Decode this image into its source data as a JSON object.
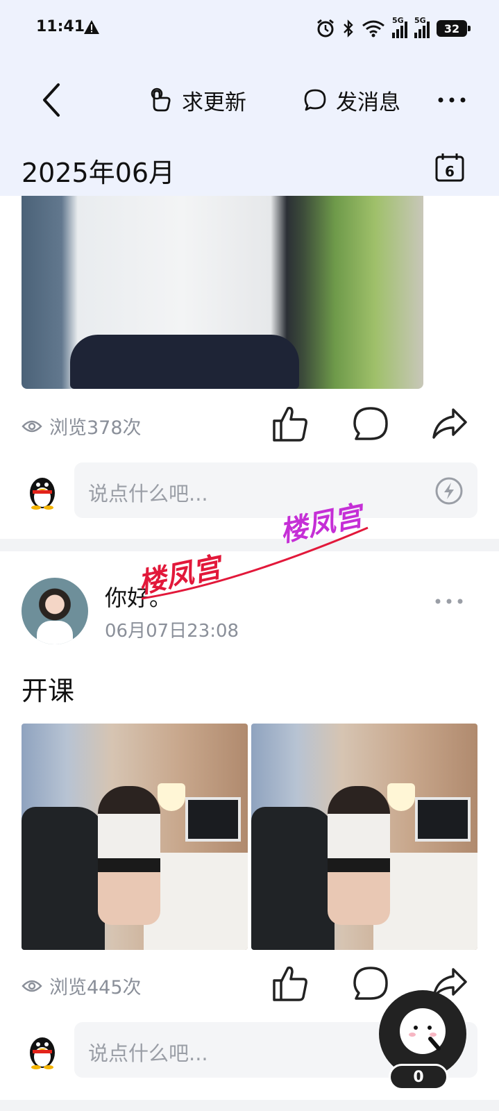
{
  "status_bar": {
    "time": "11:41",
    "battery": "32",
    "net1": "5G",
    "net2": "5G"
  },
  "nav": {
    "update_label": "求更新",
    "message_label": "发消息"
  },
  "month_label": "2025年06月",
  "calendar_day": "6",
  "post1": {
    "views": "浏览378次",
    "comment_placeholder": "说点什么吧..."
  },
  "post2": {
    "username": "你好。",
    "time": "06月07日23:08",
    "text": "开课",
    "views": "浏览445次",
    "comment_placeholder": "说点什么吧..."
  },
  "watermark": [
    "楼凤宫",
    "楼凤宫"
  ],
  "fab": {
    "count": "0"
  },
  "colors": {
    "header_bg": "#eef2fd",
    "muted": "#8a8f99",
    "watermark_red": "#e2183a",
    "watermark_purple": "#c52fd6"
  },
  "icons": [
    "warning-icon",
    "alarm-icon",
    "bluetooth-icon",
    "wifi-icon",
    "signal-icon",
    "back-icon",
    "hand-point-icon",
    "chat-bubble-icon",
    "more-icon",
    "calendar-icon",
    "eye-icon",
    "like-icon",
    "comment-icon",
    "share-icon",
    "qq-penguin-icon",
    "flash-icon"
  ]
}
